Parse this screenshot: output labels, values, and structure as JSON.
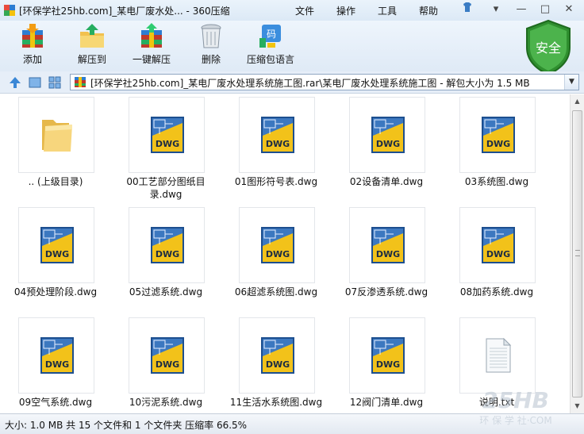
{
  "window": {
    "title": "[环保学社25hb.com]_某电厂废水处... - 360压缩",
    "menu": [
      "文件",
      "操作",
      "工具",
      "帮助"
    ]
  },
  "toolbar": {
    "add_label": "添加",
    "extract_to_label": "解压到",
    "one_click_label": "一键解压",
    "delete_label": "删除",
    "comment_label": "压缩包语言"
  },
  "security": {
    "label": "安全",
    "color": "#3aa33a"
  },
  "address": {
    "path": "[环保学社25hb.com]_某电厂废水处理系统施工图.rar\\某电厂废水处理系统施工图 - 解包大小为 1.5 MB"
  },
  "files": [
    {
      "name": ".. (上级目录)",
      "type": "folder"
    },
    {
      "name": "00工艺部分图纸目录.dwg",
      "type": "dwg"
    },
    {
      "name": "01图形符号表.dwg",
      "type": "dwg"
    },
    {
      "name": "02设备清单.dwg",
      "type": "dwg"
    },
    {
      "name": "03系统图.dwg",
      "type": "dwg"
    },
    {
      "name": "04预处理阶段.dwg",
      "type": "dwg"
    },
    {
      "name": "05过滤系统.dwg",
      "type": "dwg"
    },
    {
      "name": "06超滤系统图.dwg",
      "type": "dwg"
    },
    {
      "name": "07反渗透系统.dwg",
      "type": "dwg"
    },
    {
      "name": "08加药系统.dwg",
      "type": "dwg"
    },
    {
      "name": "09空气系统.dwg",
      "type": "dwg"
    },
    {
      "name": "10污泥系统.dwg",
      "type": "dwg"
    },
    {
      "name": "11生活水系统图.dwg",
      "type": "dwg"
    },
    {
      "name": "12阀门清单.dwg",
      "type": "dwg"
    },
    {
      "name": "说明.txt",
      "type": "txt"
    }
  ],
  "icon_badge": "DWG",
  "status": {
    "text": "大小: 1.0 MB 共 15 个文件和 1 个文件夹 压缩率 66.5%"
  },
  "watermark": {
    "brand": "25HB",
    "sub": "环 保 学 社·COM"
  }
}
